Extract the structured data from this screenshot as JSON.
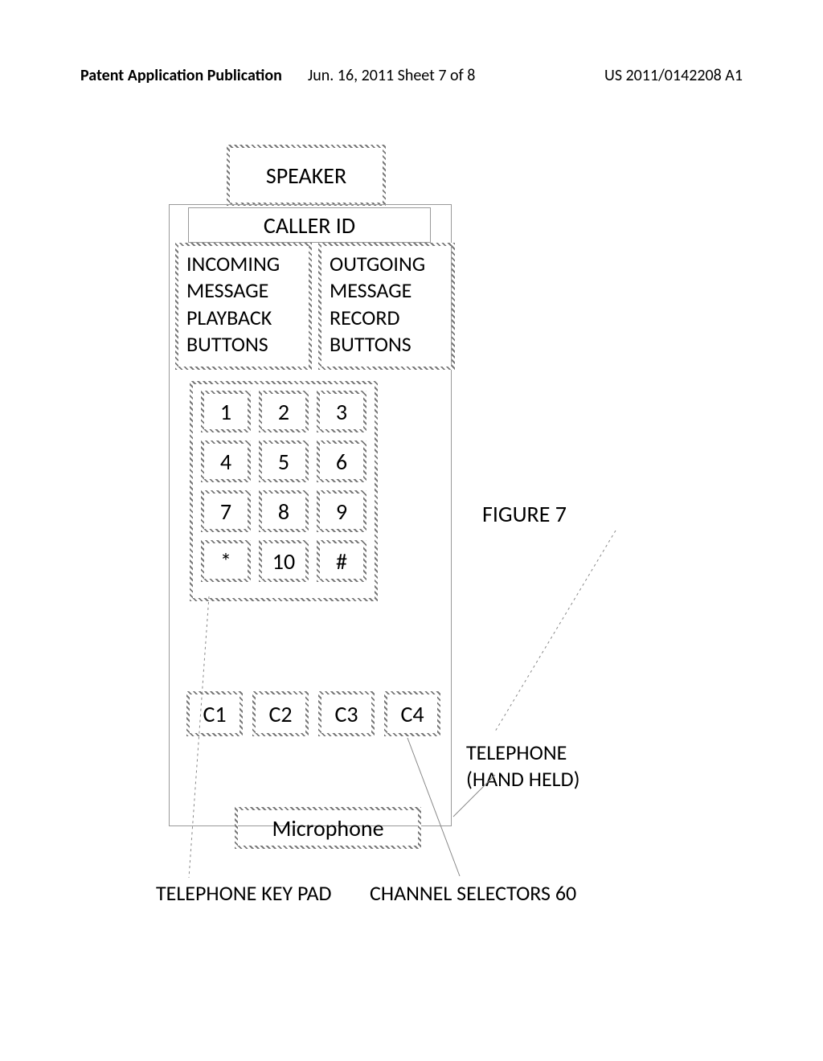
{
  "header": {
    "left": "Patent Application Publication",
    "center": "Jun. 16, 2011  Sheet 7 of 8",
    "right": "US 2011/0142208 A1"
  },
  "phone": {
    "speaker": "SPEAKER",
    "caller_id": "CALLER ID",
    "incoming": "INCOMING MESSAGE PLAYBACK BUTTONS",
    "outgoing": "OUTGOING MESSAGE RECORD BUTTONS",
    "keys": [
      "1",
      "2",
      "3",
      "4",
      "5",
      "6",
      "7",
      "8",
      "9",
      "*",
      "10",
      "#"
    ],
    "channels": [
      "C1",
      "C2",
      "C3",
      "C4"
    ],
    "microphone": "Microphone"
  },
  "labels": {
    "figure": "FIGURE 7",
    "keypad": "TELEPHONE KEY PAD",
    "channels": "CHANNEL SELECTORS  60",
    "phone": "TELEPHONE (HAND HELD)"
  }
}
